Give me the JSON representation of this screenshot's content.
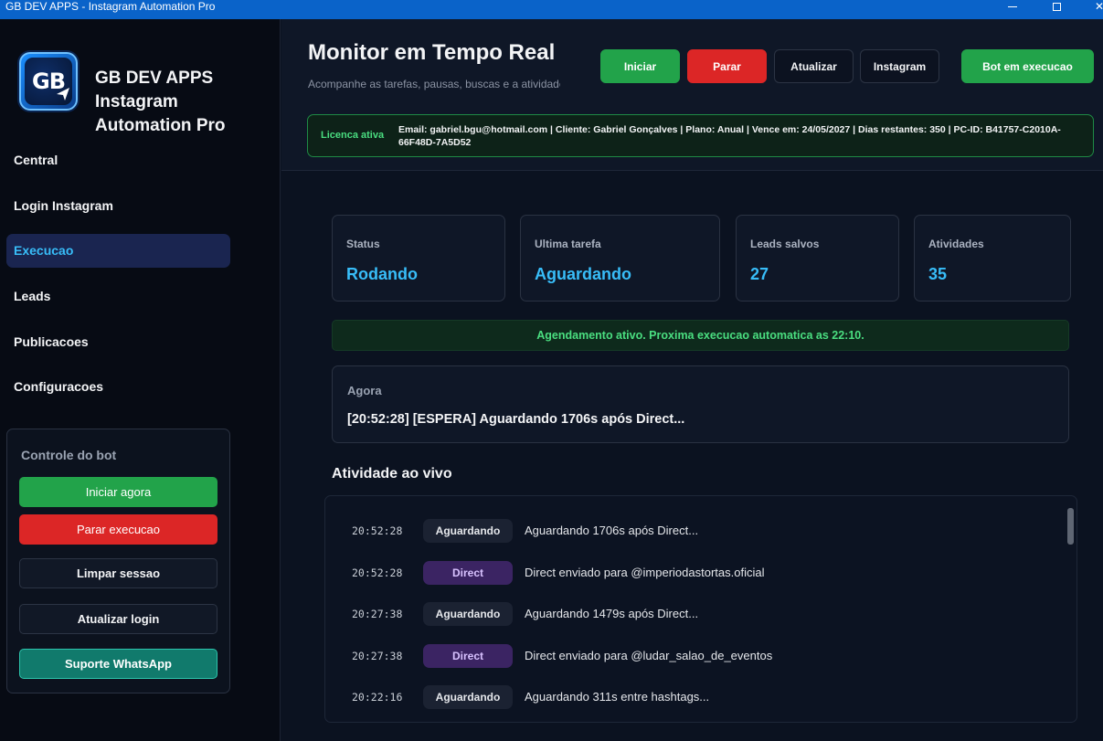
{
  "window": {
    "title": "GB DEV APPS - Instagram Automation Pro"
  },
  "sidebar": {
    "logo_text": "GB",
    "brand": "GB DEV APPS Instagram Automation Pro",
    "items": [
      {
        "label": "Central",
        "active": false
      },
      {
        "label": "Login Instagram",
        "active": false
      },
      {
        "label": "Execucao",
        "active": true
      },
      {
        "label": "Leads",
        "active": false
      },
      {
        "label": "Publicacoes",
        "active": false
      },
      {
        "label": "Configuracoes",
        "active": false
      }
    ],
    "control": {
      "title": "Controle do bot",
      "start_now": "Iniciar agora",
      "stop": "Parar execucao",
      "clear_session": "Limpar sessao",
      "refresh_login": "Atualizar login",
      "support": "Suporte WhatsApp"
    }
  },
  "header": {
    "title": "Monitor em Tempo Real",
    "subtitle": "Acompanhe as tarefas, pausas, buscas e a atividade",
    "buttons": {
      "start": "Iniciar",
      "stop": "Parar",
      "refresh": "Atualizar",
      "instagram": "Instagram",
      "bot_status": "Bot em execucao"
    },
    "license": {
      "tag": "Licenca ativa",
      "text": "Email: gabriel.bgu@hotmail.com   |   Cliente: Gabriel Gonçalves   |   Plano: Anual   |   Vence em: 24/05/2027   |   Dias restantes: 350   |   PC-ID: B41757-C2010A-66F48D-7A5D52"
    }
  },
  "cards": [
    {
      "label": "Status",
      "value": "Rodando"
    },
    {
      "label": "Ultima tarefa",
      "value": "Aguardando"
    },
    {
      "label": "Leads salvos",
      "value": "27"
    },
    {
      "label": "Atividades",
      "value": "35"
    }
  ],
  "banner": "Agendamento ativo. Proxima execucao automatica as 22:10.",
  "now": {
    "label": "Agora",
    "text": "[20:52:28] [ESPERA] Aguardando 1706s após Direct..."
  },
  "activity": {
    "title": "Atividade ao vivo",
    "rows": [
      {
        "time": "20:52:28",
        "badge": "Aguardando",
        "kind": "wait",
        "message": "Aguardando 1706s após Direct..."
      },
      {
        "time": "20:52:28",
        "badge": "Direct",
        "kind": "direct",
        "message": "Direct enviado para @imperiodastortas.oficial"
      },
      {
        "time": "20:27:38",
        "badge": "Aguardando",
        "kind": "wait",
        "message": "Aguardando 1479s após Direct..."
      },
      {
        "time": "20:27:38",
        "badge": "Direct",
        "kind": "direct",
        "message": "Direct enviado para @ludar_salao_de_eventos"
      },
      {
        "time": "20:22:16",
        "badge": "Aguardando",
        "kind": "wait",
        "message": "Aguardando 311s entre hashtags..."
      }
    ]
  },
  "colors": {
    "accent": "#38bdf8",
    "success": "#22a34a",
    "danger": "#dc2626",
    "titlebar": "#0a63c9"
  }
}
